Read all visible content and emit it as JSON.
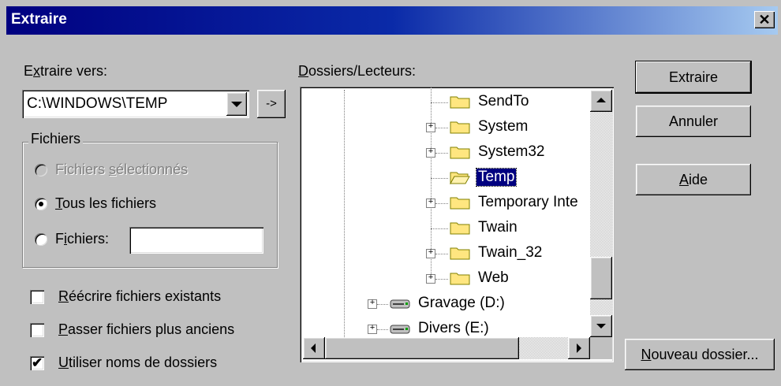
{
  "window": {
    "title": "Extraire",
    "close_glyph": "✕"
  },
  "extract_to": {
    "label_pre": "E",
    "label_ul": "x",
    "label_post": "traire vers:",
    "value": "C:\\WINDOWS\\TEMP",
    "goto_label": "->"
  },
  "files_group": {
    "legend": "Fichiers",
    "options": [
      {
        "pre": "Fichiers ",
        "ul": "s",
        "post": "électionnés",
        "selected": false,
        "disabled": true
      },
      {
        "pre": "",
        "ul": "T",
        "post": "ous les fichiers",
        "selected": true,
        "disabled": false
      },
      {
        "pre": "F",
        "ul": "i",
        "post": "chiers:",
        "selected": false,
        "disabled": false
      }
    ],
    "filter_value": ""
  },
  "checkboxes": [
    {
      "ul": "R",
      "post": "éécrire fichiers existants",
      "checked": false
    },
    {
      "ul": "P",
      "post": "asser fichiers plus anciens",
      "checked": false
    },
    {
      "ul": "U",
      "post": "tiliser noms de dossiers",
      "checked": true
    }
  ],
  "folders": {
    "label_ul": "D",
    "label_post": "ossiers/Lecteurs:",
    "items": [
      {
        "label": "SendTo",
        "type": "folder",
        "expandable": false,
        "selected": false
      },
      {
        "label": "System",
        "type": "folder",
        "expandable": true,
        "selected": false
      },
      {
        "label": "System32",
        "type": "folder",
        "expandable": true,
        "selected": false
      },
      {
        "label": "Temp",
        "type": "folder-open",
        "expandable": false,
        "selected": true
      },
      {
        "label": "Temporary Inte",
        "type": "folder",
        "expandable": true,
        "selected": false
      },
      {
        "label": "Twain",
        "type": "folder",
        "expandable": false,
        "selected": false
      },
      {
        "label": "Twain_32",
        "type": "folder",
        "expandable": true,
        "selected": false
      },
      {
        "label": "Web",
        "type": "folder",
        "expandable": true,
        "selected": false
      },
      {
        "label": "Gravage (D:)",
        "type": "drive",
        "expandable": true,
        "selected": false
      },
      {
        "label": "Divers (E:)",
        "type": "drive",
        "expandable": true,
        "selected": false
      }
    ]
  },
  "buttons": {
    "extract": "Extraire",
    "cancel": "Annuler",
    "help_ul": "A",
    "help_post": "ide",
    "new_folder_ul": "N",
    "new_folder_post": "ouveau dossier..."
  },
  "colors": {
    "title_start": "#000080",
    "title_end": "#a6caf0",
    "face": "#c0c0c0",
    "selection": "#000080",
    "folder": "#ffe680"
  }
}
